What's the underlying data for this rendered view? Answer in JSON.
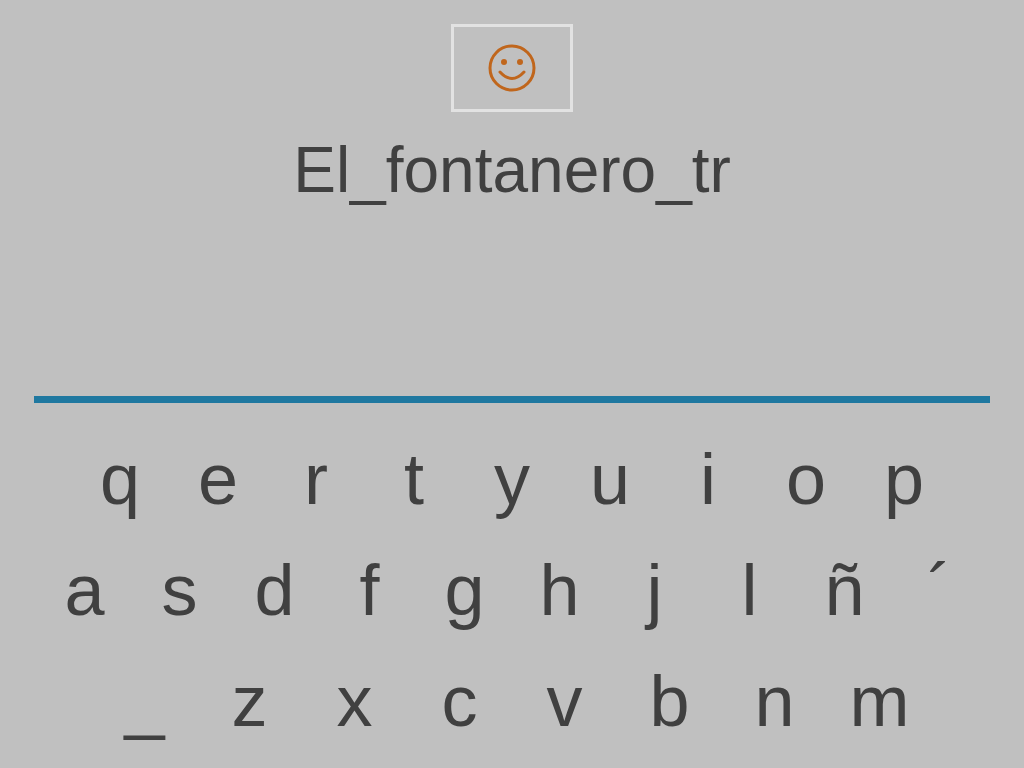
{
  "answer": {
    "text": "El_fontanero_tr"
  },
  "keyboard": {
    "rows": [
      [
        "q",
        "e",
        "r",
        "t",
        "y",
        "u",
        "i",
        "o",
        "p"
      ],
      [
        "a",
        "s",
        "d",
        "f",
        "g",
        "h",
        "j",
        "l",
        "ñ",
        "´"
      ],
      [
        "_",
        "z",
        "x",
        "c",
        "v",
        "b",
        "n",
        "m"
      ]
    ]
  }
}
